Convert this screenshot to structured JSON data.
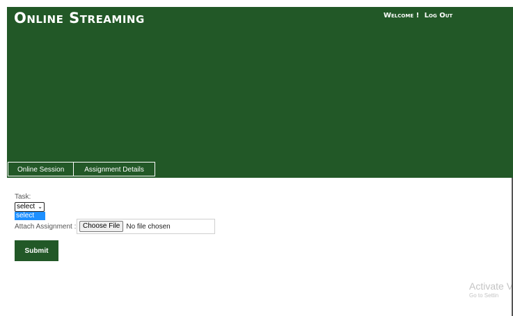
{
  "header": {
    "brand": "Online Streaming",
    "welcome": "Welcome !",
    "logout": "Log Out",
    "tabs": [
      {
        "label": "Online Session"
      },
      {
        "label": "Assignment Details"
      }
    ]
  },
  "form": {
    "task_label": "Task:",
    "task_select_value": "select",
    "task_options": [
      "select"
    ],
    "attach_label": "Attach Assignment :",
    "file_button": "Choose File",
    "file_status": "No file chosen",
    "submit_label": "Submit"
  },
  "watermark": {
    "title": "Activate V",
    "subtitle": "Go to Settin"
  },
  "colors": {
    "brand_green": "#225827",
    "select_highlight": "#1e90ff"
  }
}
